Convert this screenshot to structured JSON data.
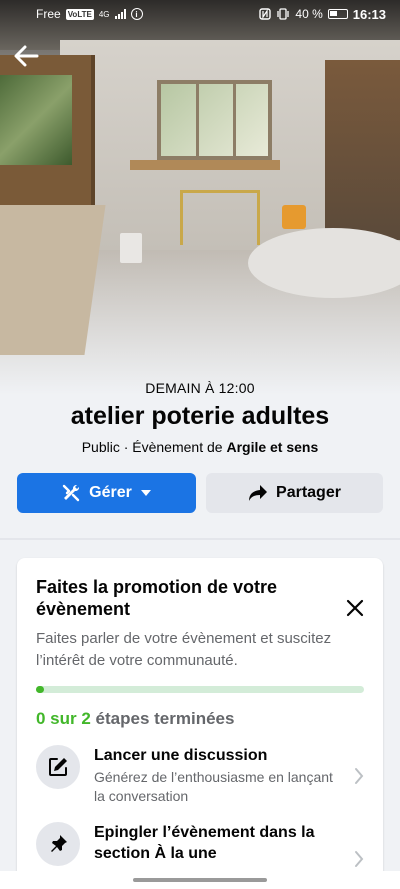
{
  "status_bar": {
    "carrier": "Free",
    "volte": "VoLTE",
    "network": "4G",
    "battery": "40 %",
    "time": "16:13"
  },
  "event": {
    "date": "DEMAIN À 12:00",
    "title": "atelier poterie adultes",
    "privacy": "Public · Évènement de ",
    "organizer": "Argile et sens"
  },
  "actions": {
    "manage_label": "Gérer",
    "share_label": "Partager"
  },
  "promo": {
    "title": "Faites la promotion de votre évènement",
    "description": "Faites parler de votre évènement et suscitez l’intérêt de votre communauté.",
    "progress_fraction": 0.02,
    "steps_done": "0 sur 2",
    "steps_label": " étapes terminées",
    "steps": [
      {
        "icon": "compose-icon",
        "title": "Lancer une discussion",
        "description": "Générez de l’enthousiasme en lançant la conversation"
      },
      {
        "icon": "pin-icon",
        "title": "Epingler l’évènement dans la section À la une",
        "description": ""
      }
    ]
  },
  "colors": {
    "primary": "#1b74e4",
    "success": "#42b72a",
    "secondary_bg": "#e4e6eb"
  }
}
